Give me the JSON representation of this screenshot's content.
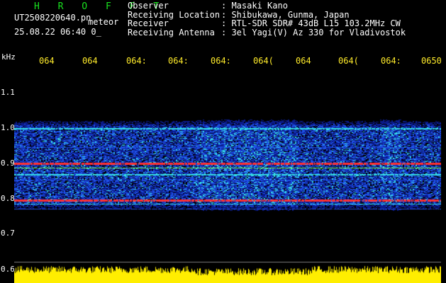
{
  "header": {
    "brand": "H R O F F T",
    "filename": "UT2508220640.pn",
    "meteor_tag": "meteor",
    "datetime": "25.08.22 06:40    0_",
    "fields": [
      {
        "label": "Observer",
        "value": ": Masaki Kano"
      },
      {
        "label": "Receiving Location",
        "value": ": Shibukawa, Gunma, Japan"
      },
      {
        "label": "Receiver",
        "value": ": RTL-SDR SDR# 43dB L15 103.2MHz CW"
      },
      {
        "label": "Receiving Antenna",
        "value": ": 3el Yagi(V) Az 330 for Vladivostok"
      }
    ]
  },
  "time_axis": {
    "labels": [
      "064",
      "064",
      "064:",
      "064:",
      "064:",
      "064(",
      "064",
      "064(",
      "064:",
      "0650"
    ]
  },
  "freq_axis": {
    "unit": "kHz",
    "ticks": [
      {
        "label": "1.1",
        "value": 1.1
      },
      {
        "label": "1.0",
        "value": 1.0
      },
      {
        "label": "0.9",
        "value": 0.9
      },
      {
        "label": "0.8",
        "value": 0.8
      },
      {
        "label": "0.7",
        "value": 0.7
      },
      {
        "label": "0.6",
        "value": 0.6
      }
    ]
  },
  "colors": {
    "background": "#000000",
    "brand": "#19e21f",
    "time_labels": "#ffeb2a",
    "power_trace": "#ffee00",
    "noise_low": "#0a1a8a",
    "noise_mid": "#1e50e6",
    "signal_cyan": "#35e0e6",
    "signal_green": "#7dff4a",
    "signal_red": "#ff3030"
  }
}
